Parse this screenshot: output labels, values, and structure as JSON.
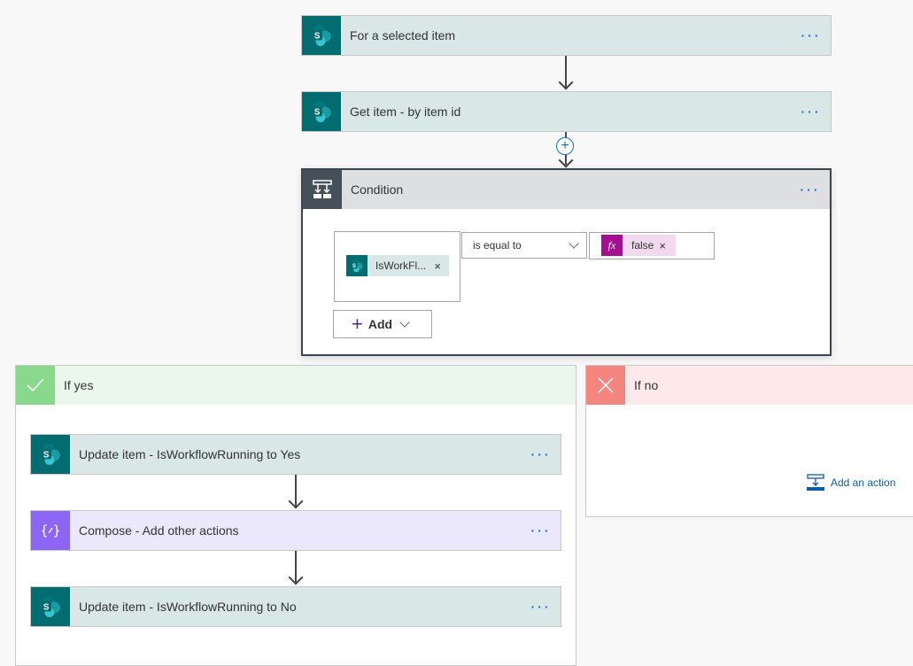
{
  "flow": {
    "steps": [
      {
        "title": "For a selected item",
        "icon": "sharepoint-icon"
      },
      {
        "title": "Get item - by item id",
        "icon": "sharepoint-icon"
      }
    ],
    "more_label": "···",
    "condition": {
      "title": "Condition",
      "left_token": "IsWorkFl...",
      "operator": "is equal to",
      "right_token": "false",
      "fx_label": "fx",
      "remove_label": "×",
      "add_label": "Add"
    },
    "if_yes": {
      "title": "If yes",
      "color_icon": "#89d98c",
      "color_head": "#eaf7ec",
      "actions": [
        {
          "title": "Update item - IsWorkflowRunning to Yes",
          "icon": "sharepoint-icon"
        },
        {
          "title": "Compose - Add other actions",
          "icon": "compose-icon"
        },
        {
          "title": "Update item - IsWorkflowRunning to No",
          "icon": "sharepoint-icon"
        }
      ]
    },
    "if_no": {
      "title": "If no",
      "color_icon": "#f4867f",
      "color_head": "#fde9e9",
      "add_action_label": "Add an action"
    }
  }
}
